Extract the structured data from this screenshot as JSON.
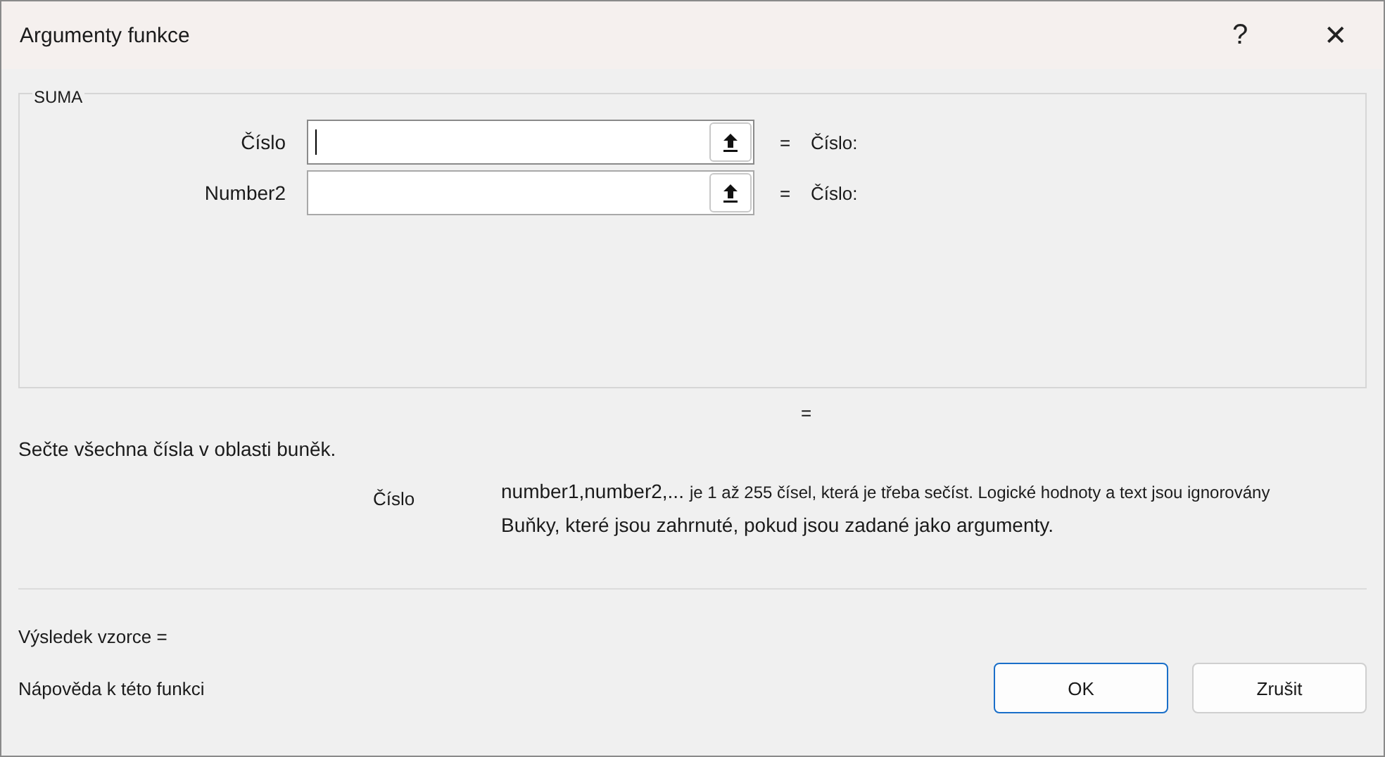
{
  "window": {
    "title": "Argumenty funkce",
    "help": "?",
    "close": "✕"
  },
  "function": {
    "name": "SUMA"
  },
  "arguments": [
    {
      "label": "Číslo",
      "focused": true,
      "equals": "=",
      "result": "Číslo:"
    },
    {
      "label": "Number2",
      "focused": false,
      "equals": "=",
      "result": "Číslo:"
    }
  ],
  "total_equals": "=",
  "description": "Sečte všechna čísla v oblasti buněk.",
  "argument_help": {
    "name": "Číslo",
    "lead": "number1,number2,...",
    "text": "je 1 až 255 čísel, která je třeba sečíst. Logické hodnoty a text jsou ignorovány",
    "line2": "Buňky, které jsou zahrnuté, pokud jsou zadané jako argumenty."
  },
  "formula_result": "Výsledek vzorce =",
  "help_link": "Nápověda k této funkci",
  "buttons": [
    {
      "label": "OK",
      "default": true
    },
    {
      "label": "Zrušit",
      "default": false
    }
  ]
}
